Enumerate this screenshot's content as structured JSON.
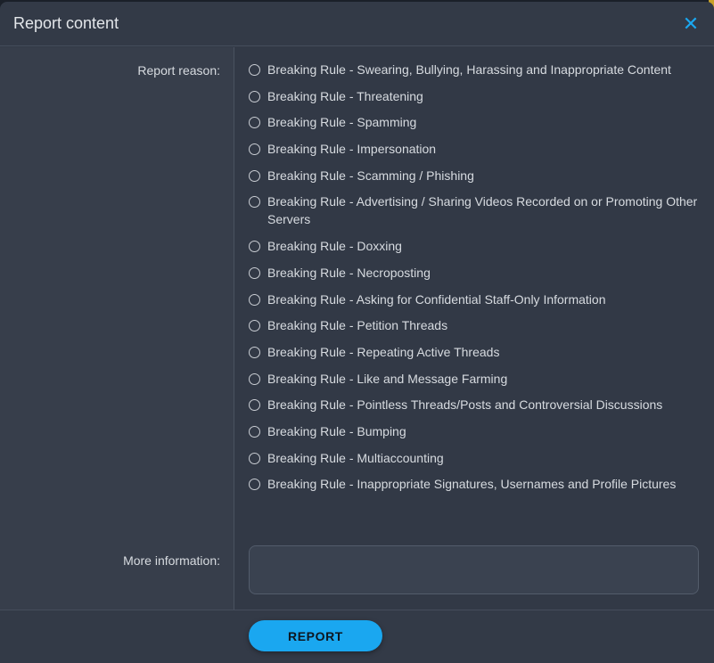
{
  "dialog": {
    "title": "Report content",
    "close_icon": "close-icon"
  },
  "form": {
    "reason_label": "Report reason:",
    "more_info_label": "More information:",
    "more_info_value": "",
    "reasons": [
      {
        "label": "Breaking Rule - Swearing, Bullying, Harassing and Inappropriate Content",
        "selected": false
      },
      {
        "label": "Breaking Rule - Threatening",
        "selected": false
      },
      {
        "label": "Breaking Rule - Spamming",
        "selected": false
      },
      {
        "label": "Breaking Rule - Impersonation",
        "selected": false
      },
      {
        "label": "Breaking Rule - Scamming / Phishing",
        "selected": false
      },
      {
        "label": "Breaking Rule - Advertising / Sharing Videos Recorded on or Promoting Other Servers",
        "selected": false
      },
      {
        "label": "Breaking Rule - Doxxing",
        "selected": false
      },
      {
        "label": "Breaking Rule - Necroposting",
        "selected": false
      },
      {
        "label": "Breaking Rule - Asking for Confidential Staff-Only Information",
        "selected": false
      },
      {
        "label": "Breaking Rule - Petition Threads",
        "selected": false
      },
      {
        "label": "Breaking Rule - Repeating Active Threads",
        "selected": false
      },
      {
        "label": "Breaking Rule - Like and Message Farming",
        "selected": false
      },
      {
        "label": "Breaking Rule - Pointless Threads/Posts and Controversial Discussions",
        "selected": false
      },
      {
        "label": "Breaking Rule - Bumping",
        "selected": false
      },
      {
        "label": "Breaking Rule - Multiaccounting",
        "selected": false
      },
      {
        "label": "Breaking Rule - Inappropriate Signatures, Usernames and Profile Pictures",
        "selected": false
      }
    ]
  },
  "footer": {
    "submit_label": "REPORT"
  },
  "colors": {
    "accent": "#1aa7f0",
    "panel": "#333a47",
    "text": "#d7dbe0"
  }
}
